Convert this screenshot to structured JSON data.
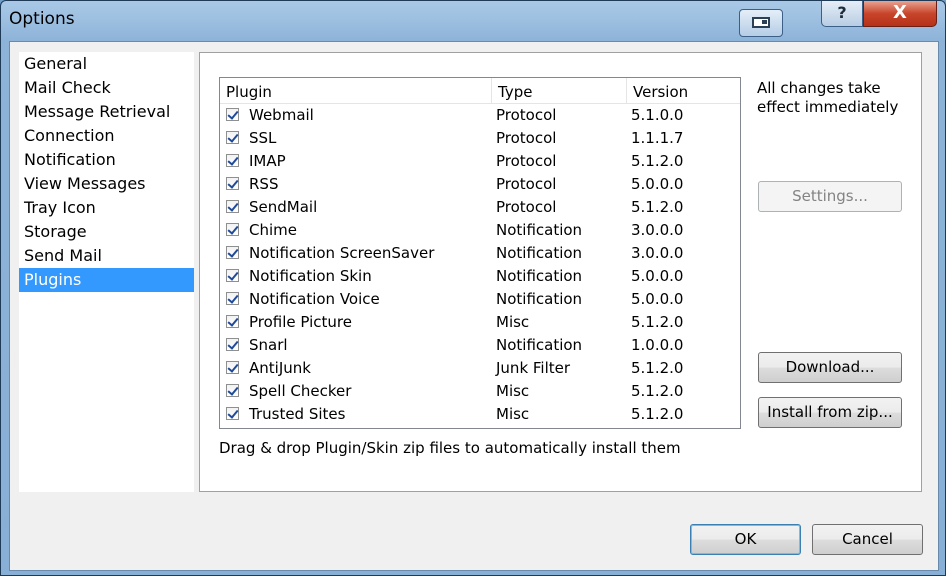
{
  "window": {
    "title": "Options",
    "help_label": "?",
    "close_label": "X"
  },
  "nav": {
    "items": [
      {
        "label": "General"
      },
      {
        "label": "Mail Check"
      },
      {
        "label": "Message Retrieval"
      },
      {
        "label": "Connection"
      },
      {
        "label": "Notification"
      },
      {
        "label": "View Messages"
      },
      {
        "label": "Tray Icon"
      },
      {
        "label": "Storage"
      },
      {
        "label": "Send Mail"
      },
      {
        "label": "Plugins"
      }
    ],
    "selected": "Plugins"
  },
  "plugins": {
    "columns": [
      "Plugin",
      "Type",
      "Version"
    ],
    "rows": [
      {
        "name": "Webmail",
        "type": "Protocol",
        "version": "5.1.0.0",
        "checked": true
      },
      {
        "name": "SSL",
        "type": "Protocol",
        "version": "1.1.1.7",
        "checked": true
      },
      {
        "name": "IMAP",
        "type": "Protocol",
        "version": "5.1.2.0",
        "checked": true
      },
      {
        "name": "RSS",
        "type": "Protocol",
        "version": "5.0.0.0",
        "checked": true
      },
      {
        "name": "SendMail",
        "type": "Protocol",
        "version": "5.1.2.0",
        "checked": true
      },
      {
        "name": "Chime",
        "type": "Notification",
        "version": "3.0.0.0",
        "checked": true
      },
      {
        "name": "Notification ScreenSaver",
        "type": "Notification",
        "version": "3.0.0.0",
        "checked": true
      },
      {
        "name": "Notification Skin",
        "type": "Notification",
        "version": "5.0.0.0",
        "checked": true
      },
      {
        "name": "Notification Voice",
        "type": "Notification",
        "version": "5.0.0.0",
        "checked": true
      },
      {
        "name": "Profile Picture",
        "type": "Misc",
        "version": "5.1.2.0",
        "checked": true
      },
      {
        "name": "Snarl",
        "type": "Notification",
        "version": "1.0.0.0",
        "checked": true
      },
      {
        "name": "AntiJunk",
        "type": "Junk Filter",
        "version": "5.1.2.0",
        "checked": true
      },
      {
        "name": "Spell Checker",
        "type": "Misc",
        "version": "5.1.2.0",
        "checked": true
      },
      {
        "name": "Trusted Sites",
        "type": "Misc",
        "version": "5.1.2.0",
        "checked": true
      }
    ],
    "note": "All changes take effect immediately",
    "drag_hint": "Drag & drop Plugin/Skin zip files to automatically install them",
    "settings_label": "Settings...",
    "download_label": "Download...",
    "install_label": "Install from zip..."
  },
  "footer": {
    "ok_label": "OK",
    "cancel_label": "Cancel"
  }
}
